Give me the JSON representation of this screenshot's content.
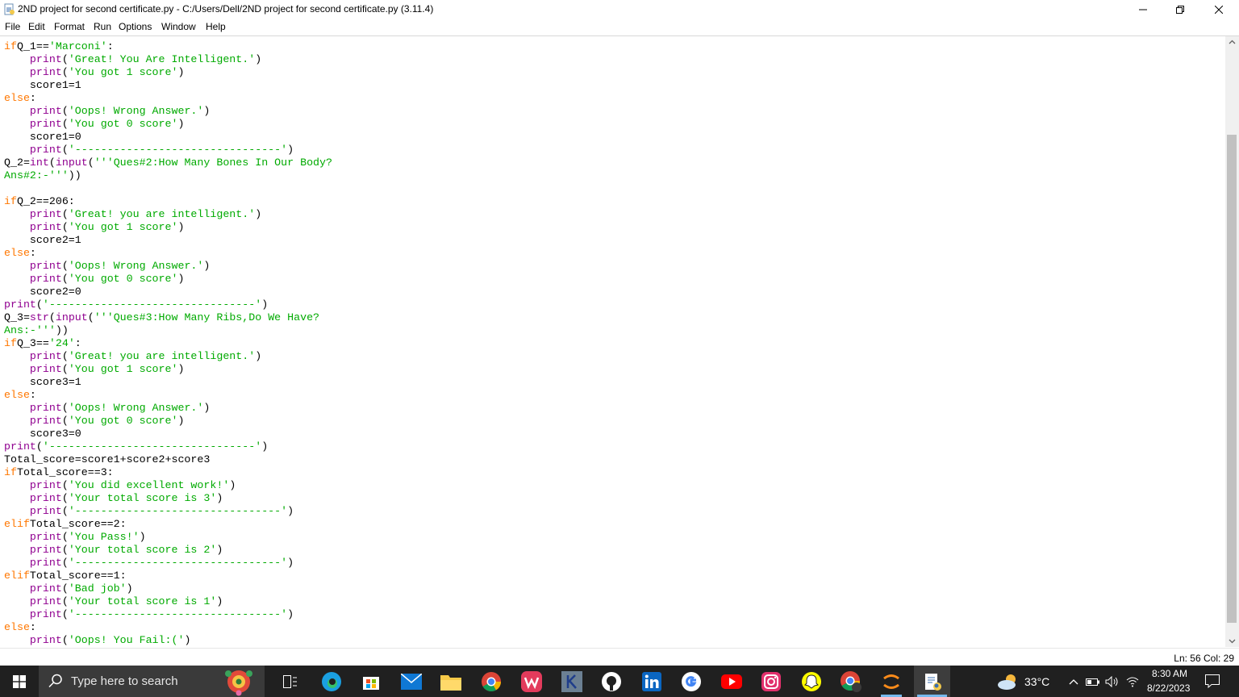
{
  "window": {
    "title": "2ND project for second certificate.py - C:/Users/Dell/2ND project for second certificate.py (3.11.4)",
    "minimize_icon": "minimize-icon",
    "restore_icon": "restore-icon",
    "close_icon": "close-icon"
  },
  "menu": [
    "File",
    "Edit",
    "Format",
    "Run",
    "Options",
    "Window",
    "Help"
  ],
  "code_lines": [
    [
      [
        "kw",
        "if"
      ],
      [
        "",
        "Q_1=="
      ],
      [
        "st",
        "'Marconi'"
      ],
      [
        "",
        ":"
      ]
    ],
    [
      [
        "",
        "    "
      ],
      [
        "bi",
        "print"
      ],
      [
        "",
        "("
      ],
      [
        "st",
        "'Great! You Are Intelligent.'"
      ],
      [
        "",
        ")"
      ]
    ],
    [
      [
        "",
        "    "
      ],
      [
        "bi",
        "print"
      ],
      [
        "",
        "("
      ],
      [
        "st",
        "'You got 1 score'"
      ],
      [
        "",
        ")"
      ]
    ],
    [
      [
        "",
        "    score1=1"
      ]
    ],
    [
      [
        "kw",
        "else"
      ],
      [
        "",
        ":"
      ]
    ],
    [
      [
        "",
        "    "
      ],
      [
        "bi",
        "print"
      ],
      [
        "",
        "("
      ],
      [
        "st",
        "'Oops! Wrong Answer.'"
      ],
      [
        "",
        ")"
      ]
    ],
    [
      [
        "",
        "    "
      ],
      [
        "bi",
        "print"
      ],
      [
        "",
        "("
      ],
      [
        "st",
        "'You got 0 score'"
      ],
      [
        "",
        ")"
      ]
    ],
    [
      [
        "",
        "    score1=0"
      ]
    ],
    [
      [
        "",
        "    "
      ],
      [
        "bi",
        "print"
      ],
      [
        "",
        "("
      ],
      [
        "st",
        "'--------------------------------'"
      ],
      [
        "",
        ")"
      ]
    ],
    [
      [
        "",
        "Q_2="
      ],
      [
        "bi",
        "int"
      ],
      [
        "",
        "("
      ],
      [
        "bi",
        "input"
      ],
      [
        "",
        "("
      ],
      [
        "st",
        "'''Ques#2:How Many Bones In Our Body?"
      ]
    ],
    [
      [
        "st",
        "Ans#2:-'''"
      ],
      [
        "",
        "))"
      ]
    ],
    [
      [
        "",
        ""
      ]
    ],
    [
      [
        "kw",
        "if"
      ],
      [
        "",
        "Q_2==206:"
      ]
    ],
    [
      [
        "",
        "    "
      ],
      [
        "bi",
        "print"
      ],
      [
        "",
        "("
      ],
      [
        "st",
        "'Great! you are intelligent.'"
      ],
      [
        "",
        ")"
      ]
    ],
    [
      [
        "",
        "    "
      ],
      [
        "bi",
        "print"
      ],
      [
        "",
        "("
      ],
      [
        "st",
        "'You got 1 score'"
      ],
      [
        "",
        ")"
      ]
    ],
    [
      [
        "",
        "    score2=1"
      ]
    ],
    [
      [
        "kw",
        "else"
      ],
      [
        "",
        ":"
      ]
    ],
    [
      [
        "",
        "    "
      ],
      [
        "bi",
        "print"
      ],
      [
        "",
        "("
      ],
      [
        "st",
        "'Oops! Wrong Answer.'"
      ],
      [
        "",
        ")"
      ]
    ],
    [
      [
        "",
        "    "
      ],
      [
        "bi",
        "print"
      ],
      [
        "",
        "("
      ],
      [
        "st",
        "'You got 0 score'"
      ],
      [
        "",
        ")"
      ]
    ],
    [
      [
        "",
        "    score2=0"
      ]
    ],
    [
      [
        "bi",
        "print"
      ],
      [
        "",
        "("
      ],
      [
        "st",
        "'--------------------------------'"
      ],
      [
        "",
        ")"
      ]
    ],
    [
      [
        "",
        "Q_3="
      ],
      [
        "bi",
        "str"
      ],
      [
        "",
        "("
      ],
      [
        "bi",
        "input"
      ],
      [
        "",
        "("
      ],
      [
        "st",
        "'''Ques#3:How Many Ribs,Do We Have?"
      ]
    ],
    [
      [
        "st",
        "Ans:-'''"
      ],
      [
        "",
        "))"
      ]
    ],
    [
      [
        "kw",
        "if"
      ],
      [
        "",
        "Q_3=="
      ],
      [
        "st",
        "'24'"
      ],
      [
        "",
        ":"
      ]
    ],
    [
      [
        "",
        "    "
      ],
      [
        "bi",
        "print"
      ],
      [
        "",
        "("
      ],
      [
        "st",
        "'Great! you are intelligent.'"
      ],
      [
        "",
        ")"
      ]
    ],
    [
      [
        "",
        "    "
      ],
      [
        "bi",
        "print"
      ],
      [
        "",
        "("
      ],
      [
        "st",
        "'You got 1 score'"
      ],
      [
        "",
        ")"
      ]
    ],
    [
      [
        "",
        "    score3=1"
      ]
    ],
    [
      [
        "kw",
        "else"
      ],
      [
        "",
        ":"
      ]
    ],
    [
      [
        "",
        "    "
      ],
      [
        "bi",
        "print"
      ],
      [
        "",
        "("
      ],
      [
        "st",
        "'Oops! Wrong Answer.'"
      ],
      [
        "",
        ")"
      ]
    ],
    [
      [
        "",
        "    "
      ],
      [
        "bi",
        "print"
      ],
      [
        "",
        "("
      ],
      [
        "st",
        "'You got 0 score'"
      ],
      [
        "",
        ")"
      ]
    ],
    [
      [
        "",
        "    score3=0"
      ]
    ],
    [
      [
        "bi",
        "print"
      ],
      [
        "",
        "("
      ],
      [
        "st",
        "'--------------------------------'"
      ],
      [
        "",
        ")"
      ]
    ],
    [
      [
        "",
        "Total_score=score1+score2+score3"
      ]
    ],
    [
      [
        "kw",
        "if"
      ],
      [
        "",
        "Total_score==3:"
      ]
    ],
    [
      [
        "",
        "    "
      ],
      [
        "bi",
        "print"
      ],
      [
        "",
        "("
      ],
      [
        "st",
        "'You did excellent work!'"
      ],
      [
        "",
        ")"
      ]
    ],
    [
      [
        "",
        "    "
      ],
      [
        "bi",
        "print"
      ],
      [
        "",
        "("
      ],
      [
        "st",
        "'Your total score is 3'"
      ],
      [
        "",
        ")"
      ]
    ],
    [
      [
        "",
        "    "
      ],
      [
        "bi",
        "print"
      ],
      [
        "",
        "("
      ],
      [
        "st",
        "'--------------------------------'"
      ],
      [
        "",
        ")"
      ]
    ],
    [
      [
        "kw",
        "elif"
      ],
      [
        "",
        "Total_score==2:"
      ]
    ],
    [
      [
        "",
        "    "
      ],
      [
        "bi",
        "print"
      ],
      [
        "",
        "("
      ],
      [
        "st",
        "'You Pass!'"
      ],
      [
        "",
        ")"
      ]
    ],
    [
      [
        "",
        "    "
      ],
      [
        "bi",
        "print"
      ],
      [
        "",
        "("
      ],
      [
        "st",
        "'Your total score is 2'"
      ],
      [
        "",
        ")"
      ]
    ],
    [
      [
        "",
        "    "
      ],
      [
        "bi",
        "print"
      ],
      [
        "",
        "("
      ],
      [
        "st",
        "'--------------------------------'"
      ],
      [
        "",
        ")"
      ]
    ],
    [
      [
        "kw",
        "elif"
      ],
      [
        "",
        "Total_score==1:"
      ]
    ],
    [
      [
        "",
        "    "
      ],
      [
        "bi",
        "print"
      ],
      [
        "",
        "("
      ],
      [
        "st",
        "'Bad job'"
      ],
      [
        "",
        ")"
      ]
    ],
    [
      [
        "",
        "    "
      ],
      [
        "bi",
        "print"
      ],
      [
        "",
        "("
      ],
      [
        "st",
        "'Your total score is 1'"
      ],
      [
        "",
        ")"
      ]
    ],
    [
      [
        "",
        "    "
      ],
      [
        "bi",
        "print"
      ],
      [
        "",
        "("
      ],
      [
        "st",
        "'--------------------------------'"
      ],
      [
        "",
        ")"
      ]
    ],
    [
      [
        "kw",
        "else"
      ],
      [
        "",
        ":"
      ]
    ],
    [
      [
        "",
        "    "
      ],
      [
        "bi",
        "print"
      ],
      [
        "",
        "("
      ],
      [
        "st",
        "'Oops! You Fail:('"
      ],
      [
        "",
        ")"
      ]
    ]
  ],
  "status": {
    "position": "Ln: 56  Col: 29"
  },
  "taskbar": {
    "search_placeholder": "Type here to search",
    "apps": [
      "task-view",
      "edge",
      "store",
      "mail",
      "file-explorer",
      "chrome",
      "wps-office",
      "kite",
      "github",
      "linkedin",
      "google",
      "youtube",
      "instagram",
      "snapchat",
      "chrome-profile",
      "chatgpt-ext",
      "idle-editor"
    ],
    "weather": "33°C",
    "time": "8:30 AM",
    "date": "8/22/2023"
  },
  "colors": {
    "keyword": "#ff7700",
    "builtin": "#900090",
    "string": "#00aa00",
    "taskbar": "#202020"
  }
}
